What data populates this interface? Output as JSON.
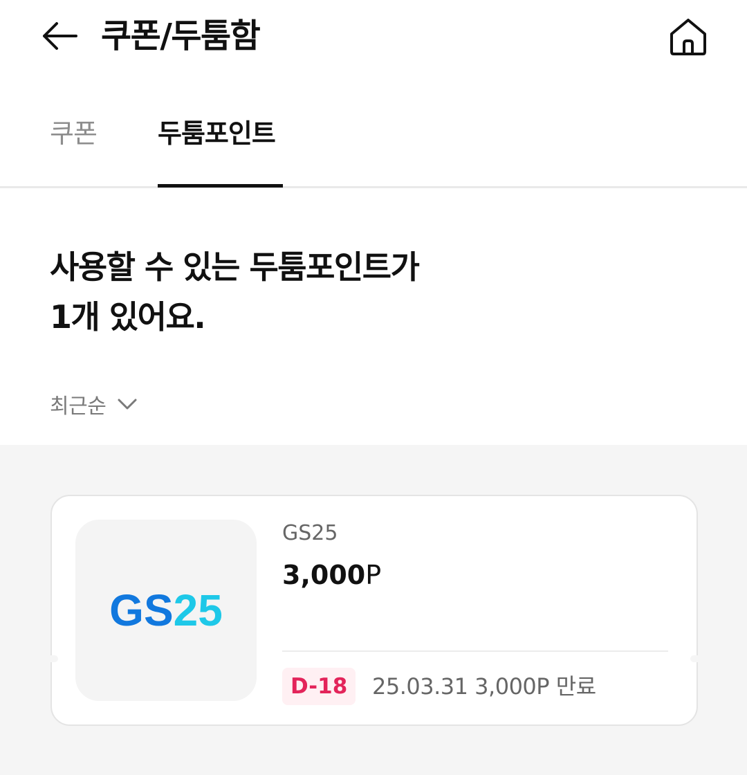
{
  "header": {
    "title": "쿠폰/두툼함"
  },
  "tabs": [
    {
      "label": "쿠폰",
      "active": false
    },
    {
      "label": "두툼포인트",
      "active": true
    }
  ],
  "summary": {
    "line1": "사용할 수 있는 두툼포인트가",
    "line2": "1개 있어요."
  },
  "sort": {
    "label": "최근순"
  },
  "points": [
    {
      "logo_text_gs": "GS",
      "logo_text_num": "25",
      "brand": "GS25",
      "amount_value": "3,000",
      "amount_unit": "P",
      "dday": "D-18",
      "expiry": "25.03.31 3,000P 만료"
    }
  ],
  "colors": {
    "accent_pink": "#e3245a",
    "logo_blue": "#1178de",
    "logo_cyan": "#1ec8e8"
  }
}
